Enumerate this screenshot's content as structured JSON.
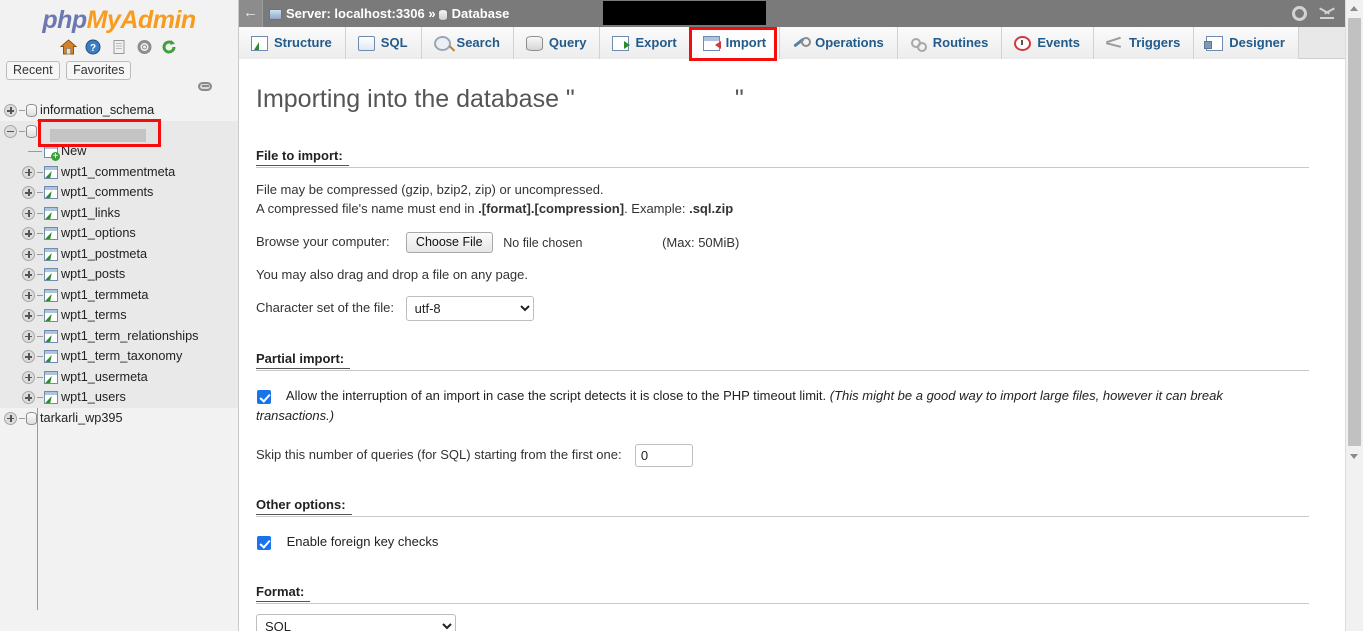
{
  "brand": {
    "php": "php",
    "my": "My",
    "admin": "Admin"
  },
  "sidebar": {
    "icons": [
      {
        "name": "home-icon",
        "glyph": "⌂"
      },
      {
        "name": "help-icon",
        "glyph": "?"
      },
      {
        "name": "documentation-icon",
        "glyph": "▤"
      },
      {
        "name": "settings-gear-icon",
        "glyph": "⚙"
      },
      {
        "name": "reload-icon",
        "glyph": "↺"
      }
    ],
    "quick_tabs": [
      {
        "label": "Recent"
      },
      {
        "label": "Favorites"
      }
    ],
    "pin_icon": "link-icon",
    "tree": [
      {
        "label": "information_schema",
        "type": "database",
        "expander": "plus",
        "level": 0,
        "shaded": false
      },
      {
        "label": "",
        "type": "database-redacted",
        "expander": "minus",
        "level": 0,
        "shaded": true
      },
      {
        "label": "New",
        "type": "new-table",
        "expander": "none",
        "level": 2,
        "shaded": true
      },
      {
        "label": "wpt1_commentmeta",
        "type": "table",
        "expander": "plus",
        "level": 1,
        "shaded": true
      },
      {
        "label": "wpt1_comments",
        "type": "table",
        "expander": "plus",
        "level": 1,
        "shaded": true
      },
      {
        "label": "wpt1_links",
        "type": "table",
        "expander": "plus",
        "level": 1,
        "shaded": true
      },
      {
        "label": "wpt1_options",
        "type": "table",
        "expander": "plus",
        "level": 1,
        "shaded": true
      },
      {
        "label": "wpt1_postmeta",
        "type": "table",
        "expander": "plus",
        "level": 1,
        "shaded": true
      },
      {
        "label": "wpt1_posts",
        "type": "table",
        "expander": "plus",
        "level": 1,
        "shaded": true
      },
      {
        "label": "wpt1_termmeta",
        "type": "table",
        "expander": "plus",
        "level": 1,
        "shaded": true
      },
      {
        "label": "wpt1_terms",
        "type": "table",
        "expander": "plus",
        "level": 1,
        "shaded": true
      },
      {
        "label": "wpt1_term_relationships",
        "type": "table",
        "expander": "plus",
        "level": 1,
        "shaded": true
      },
      {
        "label": "wpt1_term_taxonomy",
        "type": "table",
        "expander": "plus",
        "level": 1,
        "shaded": true
      },
      {
        "label": "wpt1_usermeta",
        "type": "table",
        "expander": "plus",
        "level": 1,
        "shaded": true
      },
      {
        "label": "wpt1_users",
        "type": "table",
        "expander": "plus",
        "level": 1,
        "shaded": true
      },
      {
        "label": "tarkarli_wp395",
        "type": "database",
        "expander": "plus",
        "level": 0,
        "shaded": false
      }
    ]
  },
  "topbar": {
    "back_glyph": "←",
    "server_label": "Server: localhost:3306",
    "separator": "»",
    "database_label": "Database",
    "database_name_redacted": "",
    "gear_icon": "settings-gear-icon",
    "collapse_icon": "collapse-up-icon"
  },
  "tabs": [
    {
      "label": "Structure",
      "icon": "structure-icon",
      "active": false
    },
    {
      "label": "SQL",
      "icon": "sql-icon",
      "active": false
    },
    {
      "label": "Search",
      "icon": "search-icon",
      "active": false
    },
    {
      "label": "Query",
      "icon": "query-icon",
      "active": false
    },
    {
      "label": "Export",
      "icon": "export-icon",
      "active": false
    },
    {
      "label": "Import",
      "icon": "import-icon",
      "active": true
    },
    {
      "label": "Operations",
      "icon": "operations-icon",
      "active": false
    },
    {
      "label": "Routines",
      "icon": "routines-icon",
      "active": false
    },
    {
      "label": "Events",
      "icon": "events-icon",
      "active": false
    },
    {
      "label": "Triggers",
      "icon": "triggers-icon",
      "active": false
    },
    {
      "label": "Designer",
      "icon": "designer-icon",
      "active": false
    }
  ],
  "main": {
    "title_prefix": "Importing into the database \"",
    "title_suffix": "\"",
    "file_to_import": {
      "heading": "File to import:",
      "line1": "File may be compressed (gzip, bzip2, zip) or uncompressed.",
      "line2_plain": "A compressed file's name must end in ",
      "line2_bold": ".[format].[compression]",
      "line2_mid": ". Example: ",
      "line2_bold2": ".sql.zip",
      "browse_label": "Browse your computer:",
      "choose_file_button": "Choose File",
      "no_file_chosen": "No file chosen",
      "max_size": "(Max: 50MiB)",
      "drag_drop_note": "You may also drag and drop a file on any page.",
      "charset_label": "Character set of the file:",
      "charset_value": "utf-8",
      "charset_options": [
        "utf-8"
      ]
    },
    "partial_import": {
      "heading": "Partial import:",
      "allow_interrupt_checked": true,
      "allow_interrupt_text": "Allow the interruption of an import in case the script detects it is close to the PHP timeout limit.",
      "allow_interrupt_italic": "(This might be a good way to import large files, however it can break transactions.)",
      "skip_label": "Skip this number of queries (for SQL) starting from the first one:",
      "skip_value": "0"
    },
    "other_options": {
      "heading": "Other options:",
      "fk_checked": true,
      "fk_label": "Enable foreign key checks"
    },
    "format": {
      "heading": "Format:",
      "value": "SQL",
      "options": [
        "SQL"
      ]
    }
  },
  "colors": {
    "accent_red": "#f40d0d",
    "link_blue": "#235a8a",
    "checkbox_blue": "#1a73e8",
    "topbar_gray": "#7a7a7a",
    "brand_orange": "#f79c1e",
    "brand_blue": "#6c78af"
  },
  "scrollbar": {
    "name": "vertical-scrollbar"
  }
}
